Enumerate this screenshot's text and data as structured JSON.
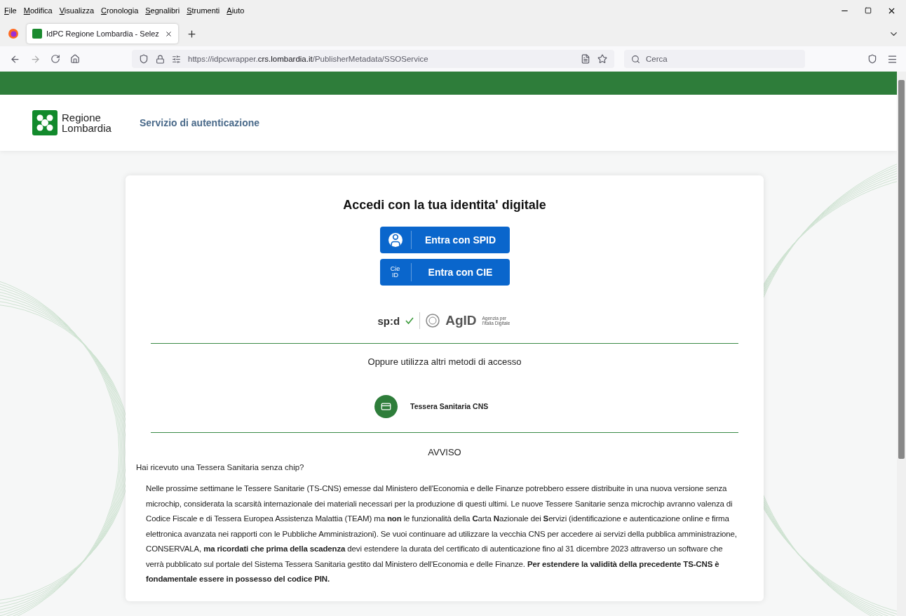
{
  "menu_bar": [
    "File",
    "Modifica",
    "Visualizza",
    "Cronologia",
    "Segnalibri",
    "Strumenti",
    "Aiuto"
  ],
  "tabs": [
    {
      "title": "IdPC Regione Lombardia - Selez",
      "selected": true
    }
  ],
  "address_bar": {
    "prefix": "https://idpcwrapper.",
    "domain": "crs.lombardia.it",
    "path": "/PublisherMetadata/SSOService"
  },
  "search": {
    "placeholder": "Cerca"
  },
  "header": {
    "logo_line_1": "Regione",
    "logo_line_2": "Lombardia",
    "service_title": "Servizio di autenticazione"
  },
  "login": {
    "title": "Accedi con la tua identita' digitale",
    "buttons": [
      {
        "kind": "spid",
        "label": "Entra con SPID"
      },
      {
        "kind": "cie",
        "label": "Entra con CIE",
        "icon_text": "Cie ID"
      }
    ],
    "spid_logo": "sp:d",
    "agid_logo": "AgID",
    "agid_caption": "Agenzia per l'Italia Digitale",
    "alternatives_title": "Oppure utilizza altri metodi di accesso",
    "alternatives": [
      {
        "label": "Tessera Sanitaria CNS"
      }
    ]
  },
  "notice": {
    "title": "AVVISO",
    "question": "Hai ricevuto una Tessera Sanitaria senza chip?",
    "body": "Nelle prossime settimane le Tessere Sanitarie (TS-CNS) emesse dal Ministero dell'Economia e delle Finanze potrebbero essere distribuite in una nuova versione senza microchip, considerata la scarsità internazionale dei materiali necessari per la produzione di questi ultimi. Le nuove Tessere Sanitarie senza microchip avranno valenza di Codice Fiscale e di Tessera Europea Assistenza Malattia (TEAM) ma **non** le funzionalità della **C**arta **N**azionale dei **S**ervizi (identificazione e autenticazione online e firma elettronica avanzata nei rapporti con le Pubbliche Amministrazioni). Se vuoi continuare ad utilizzare la vecchia CNS per accedere ai servizi della pubblica amministrazione, CONSERVALA, **ma ricordati che prima della scadenza** devi estendere la durata del certificato di autenticazione fino al 31 dicembre 2023 attraverso un software che verrà pubblicato sul portale del Sistema Tessera Sanitaria gestito dal Ministero dell'Economia e delle Finanze. **Per estendere la validità della precedente TS-CNS è fondamentale essere in possesso del codice PIN.**"
  }
}
